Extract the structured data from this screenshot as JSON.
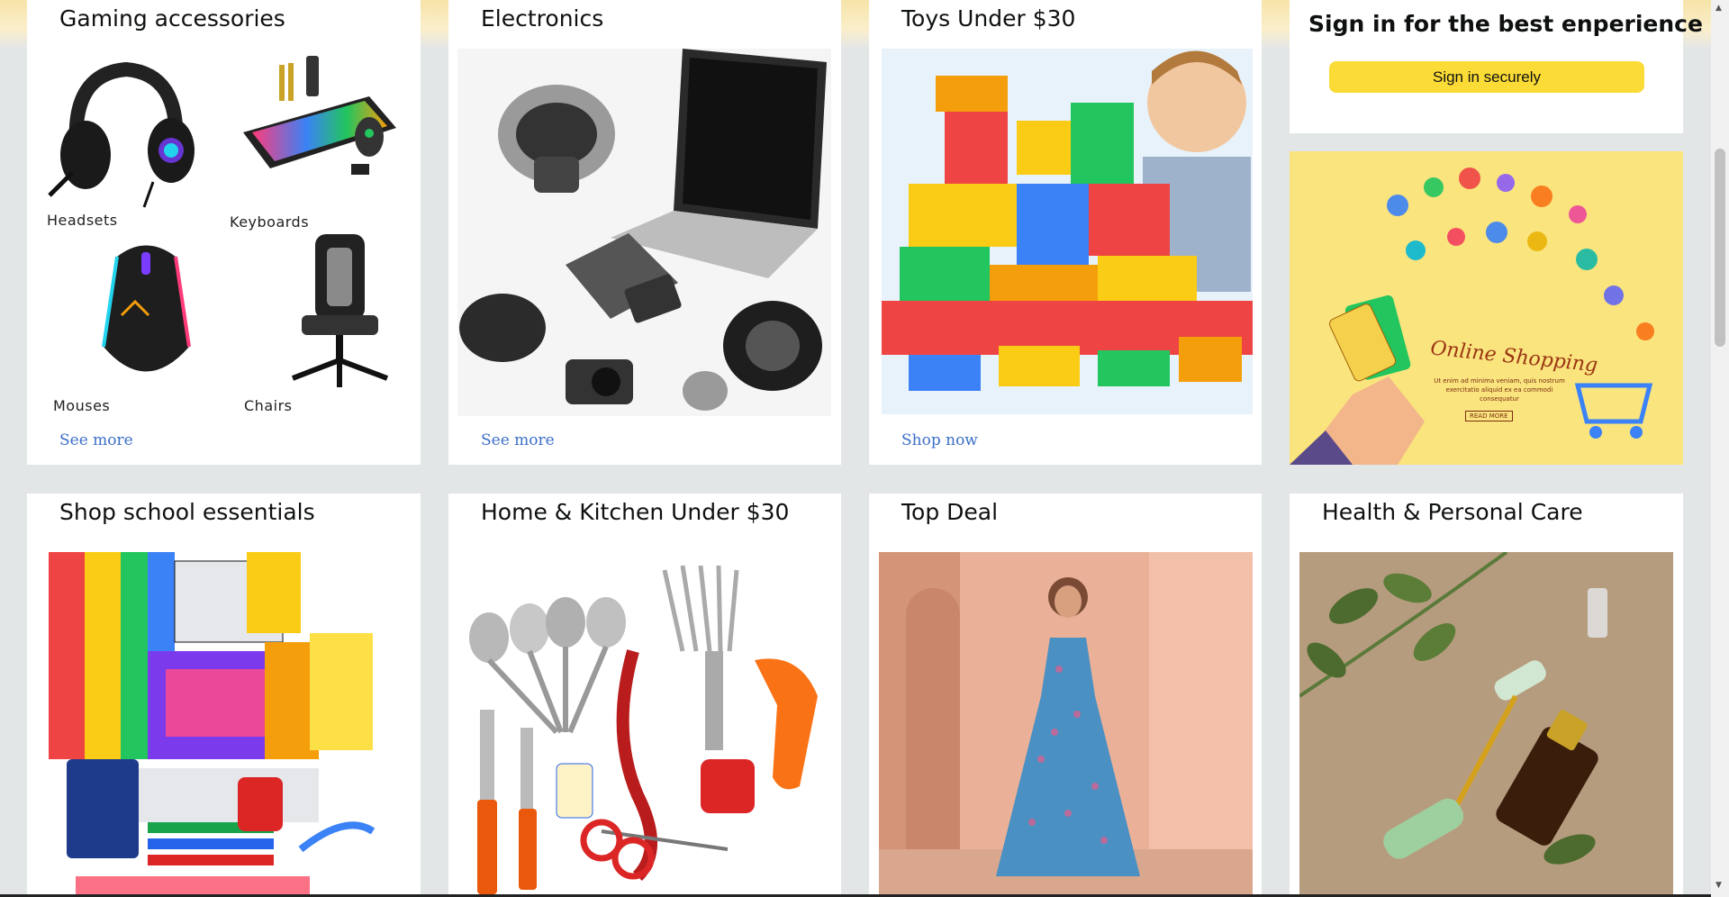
{
  "cards": {
    "gaming": {
      "title": "Gaming accessories",
      "items": [
        "Headsets",
        "Keyboards",
        "Mouses",
        "Chairs"
      ],
      "link": "See more"
    },
    "electronics": {
      "title": "Electronics",
      "link": "See more"
    },
    "toys": {
      "title": "Toys Under $30",
      "link": "Shop now"
    },
    "school": {
      "title": "Shop school essentials"
    },
    "kitchen": {
      "title": "Home & Kitchen Under $30"
    },
    "deal": {
      "title": "Top Deal"
    },
    "health": {
      "title": "Health & Personal Care"
    }
  },
  "signin": {
    "title": "Sign in for the best enperience",
    "button": "Sign in securely"
  },
  "ad_banner": {
    "headline": "Online Shopping",
    "body": "Ut enim ad minima veniam, quis nostrum exercitatio aliquid ex ea commodi consequatur",
    "cta": "READ MORE"
  },
  "colors": {
    "accent_button": "#fbdb36",
    "link": "#3b6ec8",
    "page_bg": "#e3e6e6"
  }
}
